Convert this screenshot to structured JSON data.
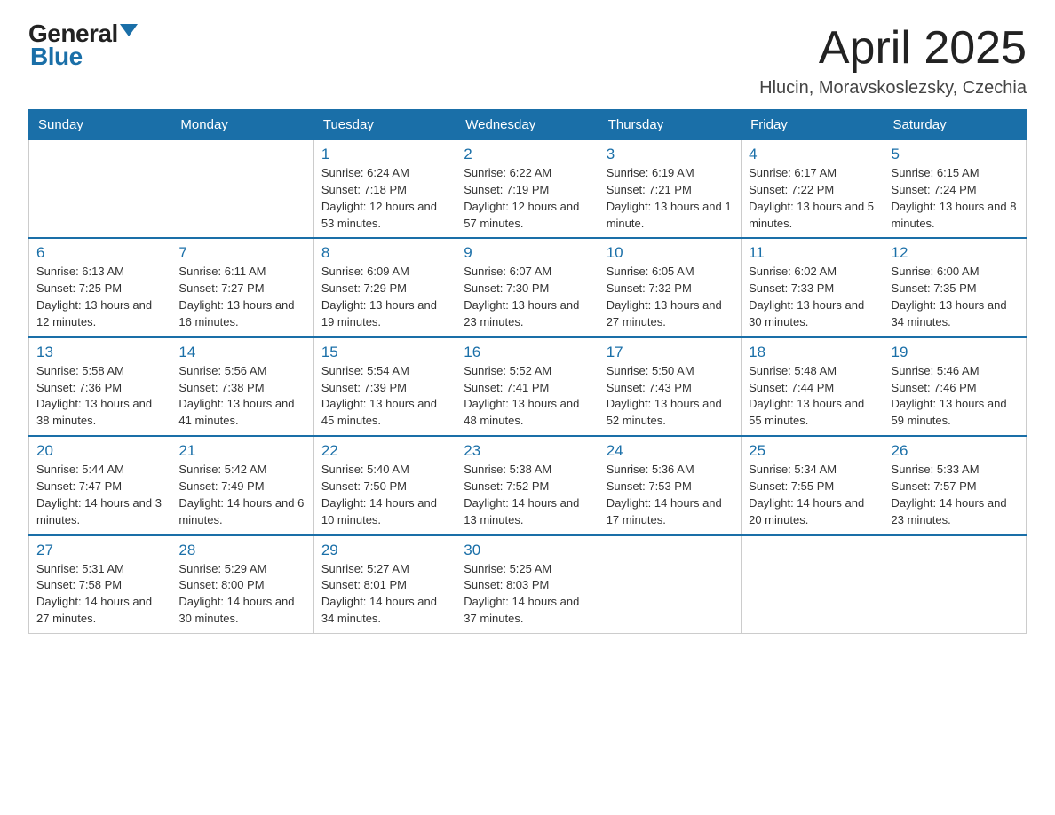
{
  "header": {
    "logo_general": "General",
    "logo_blue": "Blue",
    "month_title": "April 2025",
    "location": "Hlucin, Moravskoslezsky, Czechia"
  },
  "days_of_week": [
    "Sunday",
    "Monday",
    "Tuesday",
    "Wednesday",
    "Thursday",
    "Friday",
    "Saturday"
  ],
  "weeks": [
    [
      {
        "day": "",
        "sunrise": "",
        "sunset": "",
        "daylight": ""
      },
      {
        "day": "",
        "sunrise": "",
        "sunset": "",
        "daylight": ""
      },
      {
        "day": "1",
        "sunrise": "Sunrise: 6:24 AM",
        "sunset": "Sunset: 7:18 PM",
        "daylight": "Daylight: 12 hours and 53 minutes."
      },
      {
        "day": "2",
        "sunrise": "Sunrise: 6:22 AM",
        "sunset": "Sunset: 7:19 PM",
        "daylight": "Daylight: 12 hours and 57 minutes."
      },
      {
        "day": "3",
        "sunrise": "Sunrise: 6:19 AM",
        "sunset": "Sunset: 7:21 PM",
        "daylight": "Daylight: 13 hours and 1 minute."
      },
      {
        "day": "4",
        "sunrise": "Sunrise: 6:17 AM",
        "sunset": "Sunset: 7:22 PM",
        "daylight": "Daylight: 13 hours and 5 minutes."
      },
      {
        "day": "5",
        "sunrise": "Sunrise: 6:15 AM",
        "sunset": "Sunset: 7:24 PM",
        "daylight": "Daylight: 13 hours and 8 minutes."
      }
    ],
    [
      {
        "day": "6",
        "sunrise": "Sunrise: 6:13 AM",
        "sunset": "Sunset: 7:25 PM",
        "daylight": "Daylight: 13 hours and 12 minutes."
      },
      {
        "day": "7",
        "sunrise": "Sunrise: 6:11 AM",
        "sunset": "Sunset: 7:27 PM",
        "daylight": "Daylight: 13 hours and 16 minutes."
      },
      {
        "day": "8",
        "sunrise": "Sunrise: 6:09 AM",
        "sunset": "Sunset: 7:29 PM",
        "daylight": "Daylight: 13 hours and 19 minutes."
      },
      {
        "day": "9",
        "sunrise": "Sunrise: 6:07 AM",
        "sunset": "Sunset: 7:30 PM",
        "daylight": "Daylight: 13 hours and 23 minutes."
      },
      {
        "day": "10",
        "sunrise": "Sunrise: 6:05 AM",
        "sunset": "Sunset: 7:32 PM",
        "daylight": "Daylight: 13 hours and 27 minutes."
      },
      {
        "day": "11",
        "sunrise": "Sunrise: 6:02 AM",
        "sunset": "Sunset: 7:33 PM",
        "daylight": "Daylight: 13 hours and 30 minutes."
      },
      {
        "day": "12",
        "sunrise": "Sunrise: 6:00 AM",
        "sunset": "Sunset: 7:35 PM",
        "daylight": "Daylight: 13 hours and 34 minutes."
      }
    ],
    [
      {
        "day": "13",
        "sunrise": "Sunrise: 5:58 AM",
        "sunset": "Sunset: 7:36 PM",
        "daylight": "Daylight: 13 hours and 38 minutes."
      },
      {
        "day": "14",
        "sunrise": "Sunrise: 5:56 AM",
        "sunset": "Sunset: 7:38 PM",
        "daylight": "Daylight: 13 hours and 41 minutes."
      },
      {
        "day": "15",
        "sunrise": "Sunrise: 5:54 AM",
        "sunset": "Sunset: 7:39 PM",
        "daylight": "Daylight: 13 hours and 45 minutes."
      },
      {
        "day": "16",
        "sunrise": "Sunrise: 5:52 AM",
        "sunset": "Sunset: 7:41 PM",
        "daylight": "Daylight: 13 hours and 48 minutes."
      },
      {
        "day": "17",
        "sunrise": "Sunrise: 5:50 AM",
        "sunset": "Sunset: 7:43 PM",
        "daylight": "Daylight: 13 hours and 52 minutes."
      },
      {
        "day": "18",
        "sunrise": "Sunrise: 5:48 AM",
        "sunset": "Sunset: 7:44 PM",
        "daylight": "Daylight: 13 hours and 55 minutes."
      },
      {
        "day": "19",
        "sunrise": "Sunrise: 5:46 AM",
        "sunset": "Sunset: 7:46 PM",
        "daylight": "Daylight: 13 hours and 59 minutes."
      }
    ],
    [
      {
        "day": "20",
        "sunrise": "Sunrise: 5:44 AM",
        "sunset": "Sunset: 7:47 PM",
        "daylight": "Daylight: 14 hours and 3 minutes."
      },
      {
        "day": "21",
        "sunrise": "Sunrise: 5:42 AM",
        "sunset": "Sunset: 7:49 PM",
        "daylight": "Daylight: 14 hours and 6 minutes."
      },
      {
        "day": "22",
        "sunrise": "Sunrise: 5:40 AM",
        "sunset": "Sunset: 7:50 PM",
        "daylight": "Daylight: 14 hours and 10 minutes."
      },
      {
        "day": "23",
        "sunrise": "Sunrise: 5:38 AM",
        "sunset": "Sunset: 7:52 PM",
        "daylight": "Daylight: 14 hours and 13 minutes."
      },
      {
        "day": "24",
        "sunrise": "Sunrise: 5:36 AM",
        "sunset": "Sunset: 7:53 PM",
        "daylight": "Daylight: 14 hours and 17 minutes."
      },
      {
        "day": "25",
        "sunrise": "Sunrise: 5:34 AM",
        "sunset": "Sunset: 7:55 PM",
        "daylight": "Daylight: 14 hours and 20 minutes."
      },
      {
        "day": "26",
        "sunrise": "Sunrise: 5:33 AM",
        "sunset": "Sunset: 7:57 PM",
        "daylight": "Daylight: 14 hours and 23 minutes."
      }
    ],
    [
      {
        "day": "27",
        "sunrise": "Sunrise: 5:31 AM",
        "sunset": "Sunset: 7:58 PM",
        "daylight": "Daylight: 14 hours and 27 minutes."
      },
      {
        "day": "28",
        "sunrise": "Sunrise: 5:29 AM",
        "sunset": "Sunset: 8:00 PM",
        "daylight": "Daylight: 14 hours and 30 minutes."
      },
      {
        "day": "29",
        "sunrise": "Sunrise: 5:27 AM",
        "sunset": "Sunset: 8:01 PM",
        "daylight": "Daylight: 14 hours and 34 minutes."
      },
      {
        "day": "30",
        "sunrise": "Sunrise: 5:25 AM",
        "sunset": "Sunset: 8:03 PM",
        "daylight": "Daylight: 14 hours and 37 minutes."
      },
      {
        "day": "",
        "sunrise": "",
        "sunset": "",
        "daylight": ""
      },
      {
        "day": "",
        "sunrise": "",
        "sunset": "",
        "daylight": ""
      },
      {
        "day": "",
        "sunrise": "",
        "sunset": "",
        "daylight": ""
      }
    ]
  ]
}
